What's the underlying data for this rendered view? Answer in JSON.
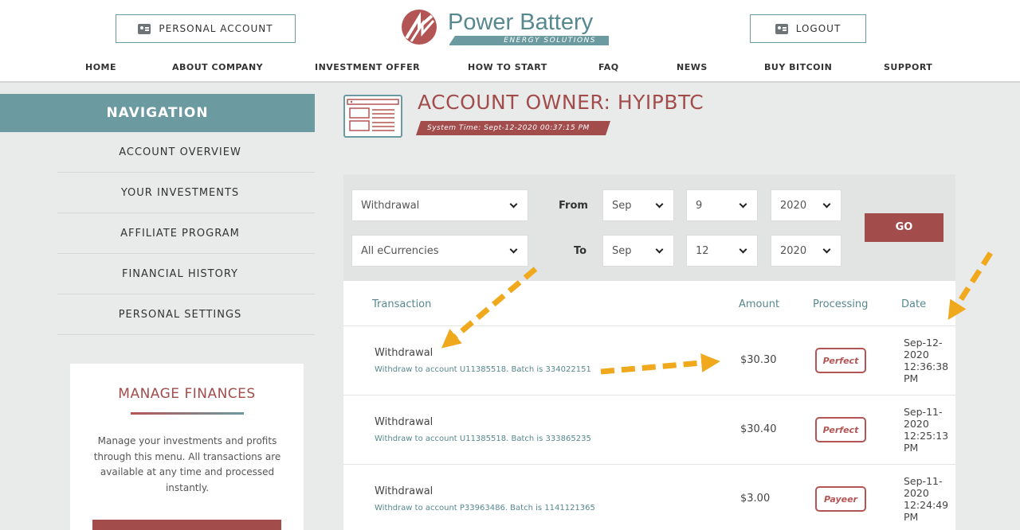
{
  "header": {
    "personal_account": "PERSONAL ACCOUNT",
    "logout": "LOGOUT",
    "logo_title": "Power Battery",
    "logo_subtitle": "ENERGY SOLUTIONS",
    "nav": [
      "HOME",
      "ABOUT COMPANY",
      "INVESTMENT OFFER",
      "HOW TO START",
      "FAQ",
      "NEWS",
      "BUY BITCOIN",
      "SUPPORT"
    ]
  },
  "sidebar": {
    "title": "NAVIGATION",
    "items": [
      "ACCOUNT OVERVIEW",
      "YOUR INVESTMENTS",
      "AFFILIATE PROGRAM",
      "FINANCIAL HISTORY",
      "PERSONAL SETTINGS"
    ],
    "manage": {
      "title": "MANAGE FINANCES",
      "text": "Manage your investments and profits through this menu. All transactions are available at any time and processed instantly."
    }
  },
  "main": {
    "title": "ACCOUNT OWNER: HYIPBTC",
    "system_time": "System Time: Sept-12-2020 00:37:15 PM"
  },
  "filter": {
    "type": "Withdrawal",
    "currency": "All eCurrencies",
    "from_label": "From",
    "to_label": "To",
    "from_month": "Sep",
    "from_day": "9",
    "from_year": "2020",
    "to_month": "Sep",
    "to_day": "12",
    "to_year": "2020",
    "go": "GO"
  },
  "table": {
    "headers": {
      "transaction": "Transaction",
      "amount": "Amount",
      "processing": "Processing",
      "date": "Date"
    },
    "rows": [
      {
        "name": "Withdrawal",
        "desc": "Withdraw to account U11385518. Batch is 334022151",
        "amount": "$30.30",
        "processor": "Perfect",
        "date": [
          "Sep-12-",
          "2020",
          "12:36:38",
          "PM"
        ]
      },
      {
        "name": "Withdrawal",
        "desc": "Withdraw to account U11385518. Batch is 333865235",
        "amount": "$30.40",
        "processor": "Perfect",
        "date": [
          "Sep-11-",
          "2020",
          "12:25:13",
          "PM"
        ]
      },
      {
        "name": "Withdrawal",
        "desc": "Withdraw to account P33963486. Batch is 1141121365",
        "amount": "$3.00",
        "processor": "Payeer",
        "date": [
          "Sep-11-",
          "2020",
          "12:24:49",
          "PM"
        ]
      }
    ]
  },
  "colors": {
    "accent_red": "#a34c4c",
    "teal": "#6b9aa0",
    "arrow": "#f0a81c"
  }
}
